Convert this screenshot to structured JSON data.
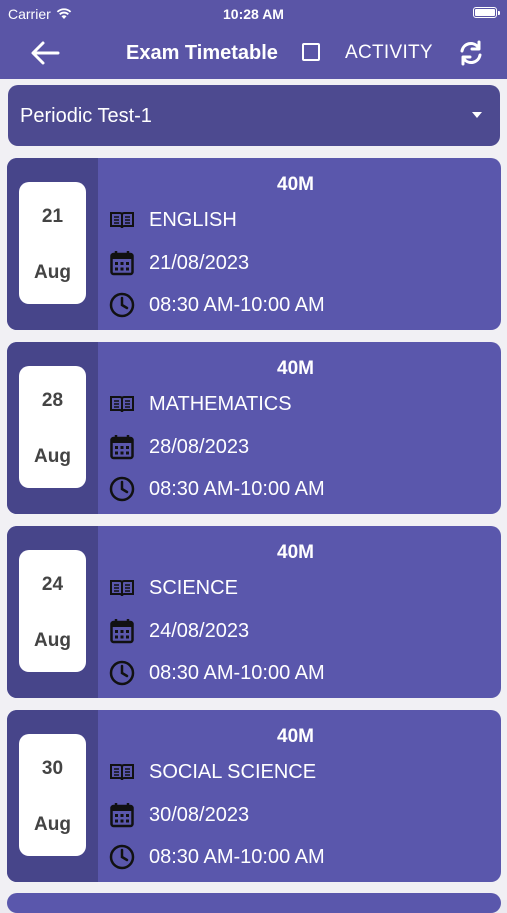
{
  "status": {
    "carrier": "Carrier",
    "time": "10:28 AM"
  },
  "header": {
    "title": "Exam Timetable",
    "activity_label": "ACTIVITY"
  },
  "dropdown": {
    "selected": "Periodic Test-1"
  },
  "exams": [
    {
      "day": "21",
      "month": "Aug",
      "marks": "40M",
      "subject": "ENGLISH",
      "date": "21/08/2023",
      "time": "08:30 AM-10:00 AM"
    },
    {
      "day": "28",
      "month": "Aug",
      "marks": "40M",
      "subject": "MATHEMATICS",
      "date": "28/08/2023",
      "time": "08:30 AM-10:00 AM"
    },
    {
      "day": "24",
      "month": "Aug",
      "marks": "40M",
      "subject": "SCIENCE",
      "date": "24/08/2023",
      "time": "08:30 AM-10:00 AM"
    },
    {
      "day": "30",
      "month": "Aug",
      "marks": "40M",
      "subject": "SOCIAL SCIENCE",
      "date": "30/08/2023",
      "time": "08:30 AM-10:00 AM"
    }
  ],
  "icons": {
    "back": "arrow-left-icon",
    "refresh": "refresh-icon",
    "subject": "book-icon",
    "date": "calendar-icon",
    "time": "clock-icon"
  },
  "colors": {
    "primary": "#5a55a6",
    "card": "#5a57ac",
    "card_side": "#47458a",
    "dropdown": "#4d4a90"
  }
}
